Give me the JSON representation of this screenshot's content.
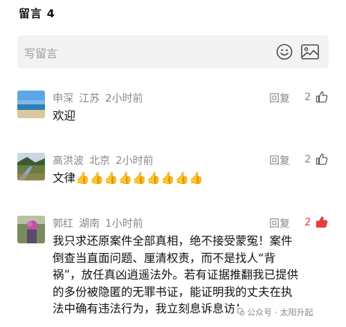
{
  "header": {
    "title": "留言 4"
  },
  "input": {
    "placeholder": "写留言",
    "emoji_icon": "smile-emoji-icon",
    "image_icon": "image-icon"
  },
  "comments": [
    {
      "name": "申深",
      "location": "江苏",
      "time": "2小时前",
      "reply": "回复",
      "likes": "2",
      "liked": false,
      "text": "欢迎"
    },
    {
      "name": "高洪波",
      "location": "北京",
      "time": "2小时前",
      "reply": "回复",
      "likes": "2",
      "liked": false,
      "text": "文律👍👍👍👍👍👍👍👍👍"
    },
    {
      "name": "郭红",
      "location": "湖南",
      "time": "1小时前",
      "reply": "回复",
      "likes": "2",
      "liked": true,
      "lines": [
        "我只求还原案件全部真相，绝不接受蒙冤！案件",
        "倒查当直面问题、厘清权责，而不是找人“背",
        "祸”，放任真凶逍遥法外。若有证据推翻我已提供",
        "的多份被隐匿的无罪书证，能证明我的丈夫在执",
        "法中确有违法行为，我立刻息诉息访！"
      ]
    }
  ],
  "watermark": {
    "text": "公众号 · 太阳升起"
  },
  "colors": {
    "like_active": "#e0403c",
    "muted": "#888888",
    "input_bg": "#f3f3f3"
  }
}
